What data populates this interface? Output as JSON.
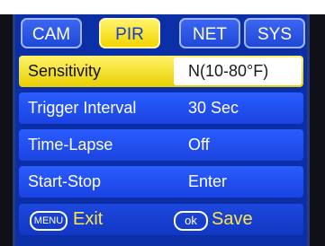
{
  "tabs": [
    {
      "label": "CAM",
      "active": false
    },
    {
      "label": "PIR",
      "active": true
    },
    {
      "label": "NET",
      "active": false
    },
    {
      "label": "SYS",
      "active": false
    }
  ],
  "settings": [
    {
      "label": "Sensitivity",
      "value": "N(10-80°F)",
      "selected": true
    },
    {
      "label": "Trigger Interval",
      "value": "30 Sec",
      "selected": false
    },
    {
      "label": "Time-Lapse",
      "value": "Off",
      "selected": false
    },
    {
      "label": "Start-Stop",
      "value": "Enter",
      "selected": false
    }
  ],
  "footer": {
    "menu_key": "MENU",
    "menu_action": "Exit",
    "ok_key": "ok",
    "ok_action": "Save"
  },
  "colors": {
    "panel_bg": "#0b2fa6",
    "row_bg": "#2a5cff",
    "highlight": "#fff36a",
    "footer_text": "#ffe34a"
  }
}
